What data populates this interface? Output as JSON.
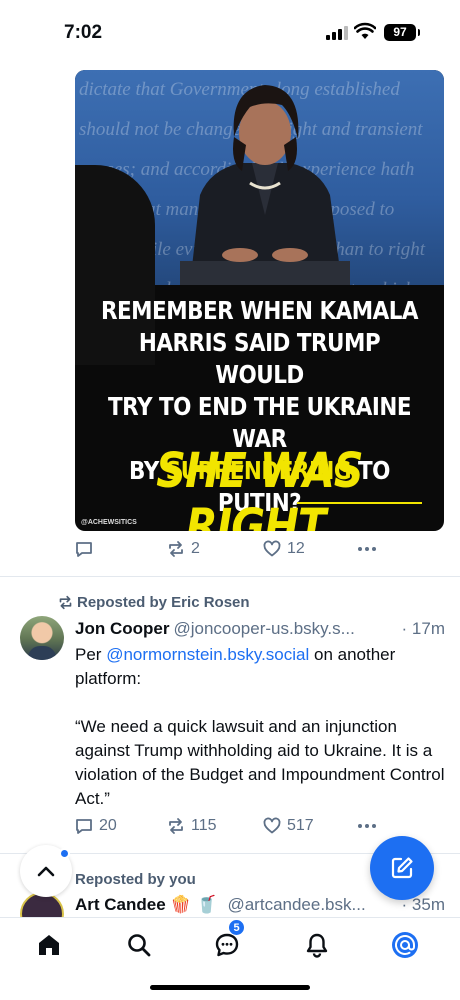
{
  "status_bar": {
    "time": "7:02",
    "battery": "97"
  },
  "image_post": {
    "bg_text": "dictate that Governments long established should not be changed for light and transient causes; and accordingly all experience hath shewn that mankind are more disposed to suffer, while evils are sufferable, than to right themselves by abolishing the forms to which they are accustomed. But when a long train of abuses and usurpations, pursuing invariably the same Object evinces a design",
    "headline_1": "REMEMBER WHEN KAMALA",
    "headline_2": "HARRIS SAID TRUMP WOULD",
    "headline_3": "TRY TO END THE UKRAINE WAR",
    "headline_4_pre": "BY ",
    "headline_4_hl": "SURRENDERING",
    "headline_4_post": " TO PUTIN?",
    "punchline": "SHE WAS RIGHT.",
    "credit": "@ACHEWSITICS",
    "actions": {
      "reposts": "2",
      "likes": "12"
    }
  },
  "post2": {
    "repost_label": "Reposted by Eric Rosen",
    "author": "Jon Cooper",
    "handle": "@joncooper-us.bsky.s...",
    "time": "· 17m",
    "text_pre": "Per ",
    "mention": "@normornstein.bsky.social",
    "text_post": " on another platform:",
    "quote": "“We need a quick lawsuit and an injunction against Trump withholding aid to Ukraine. It is a violation of the Budget and Impoundment Control Act.”",
    "actions": {
      "replies": "20",
      "reposts": "115",
      "likes": "517"
    }
  },
  "post3": {
    "repost_label": "Reposted by you",
    "author": "Art Candee 🍿 🥤",
    "handle": "@artcandee.bsk...",
    "time": "· 35m"
  },
  "tabbar": {
    "notifications_badge": "5"
  },
  "colors": {
    "accent": "#1d6ff2",
    "muted": "#5d6f86",
    "highlight": "#f2e500"
  }
}
